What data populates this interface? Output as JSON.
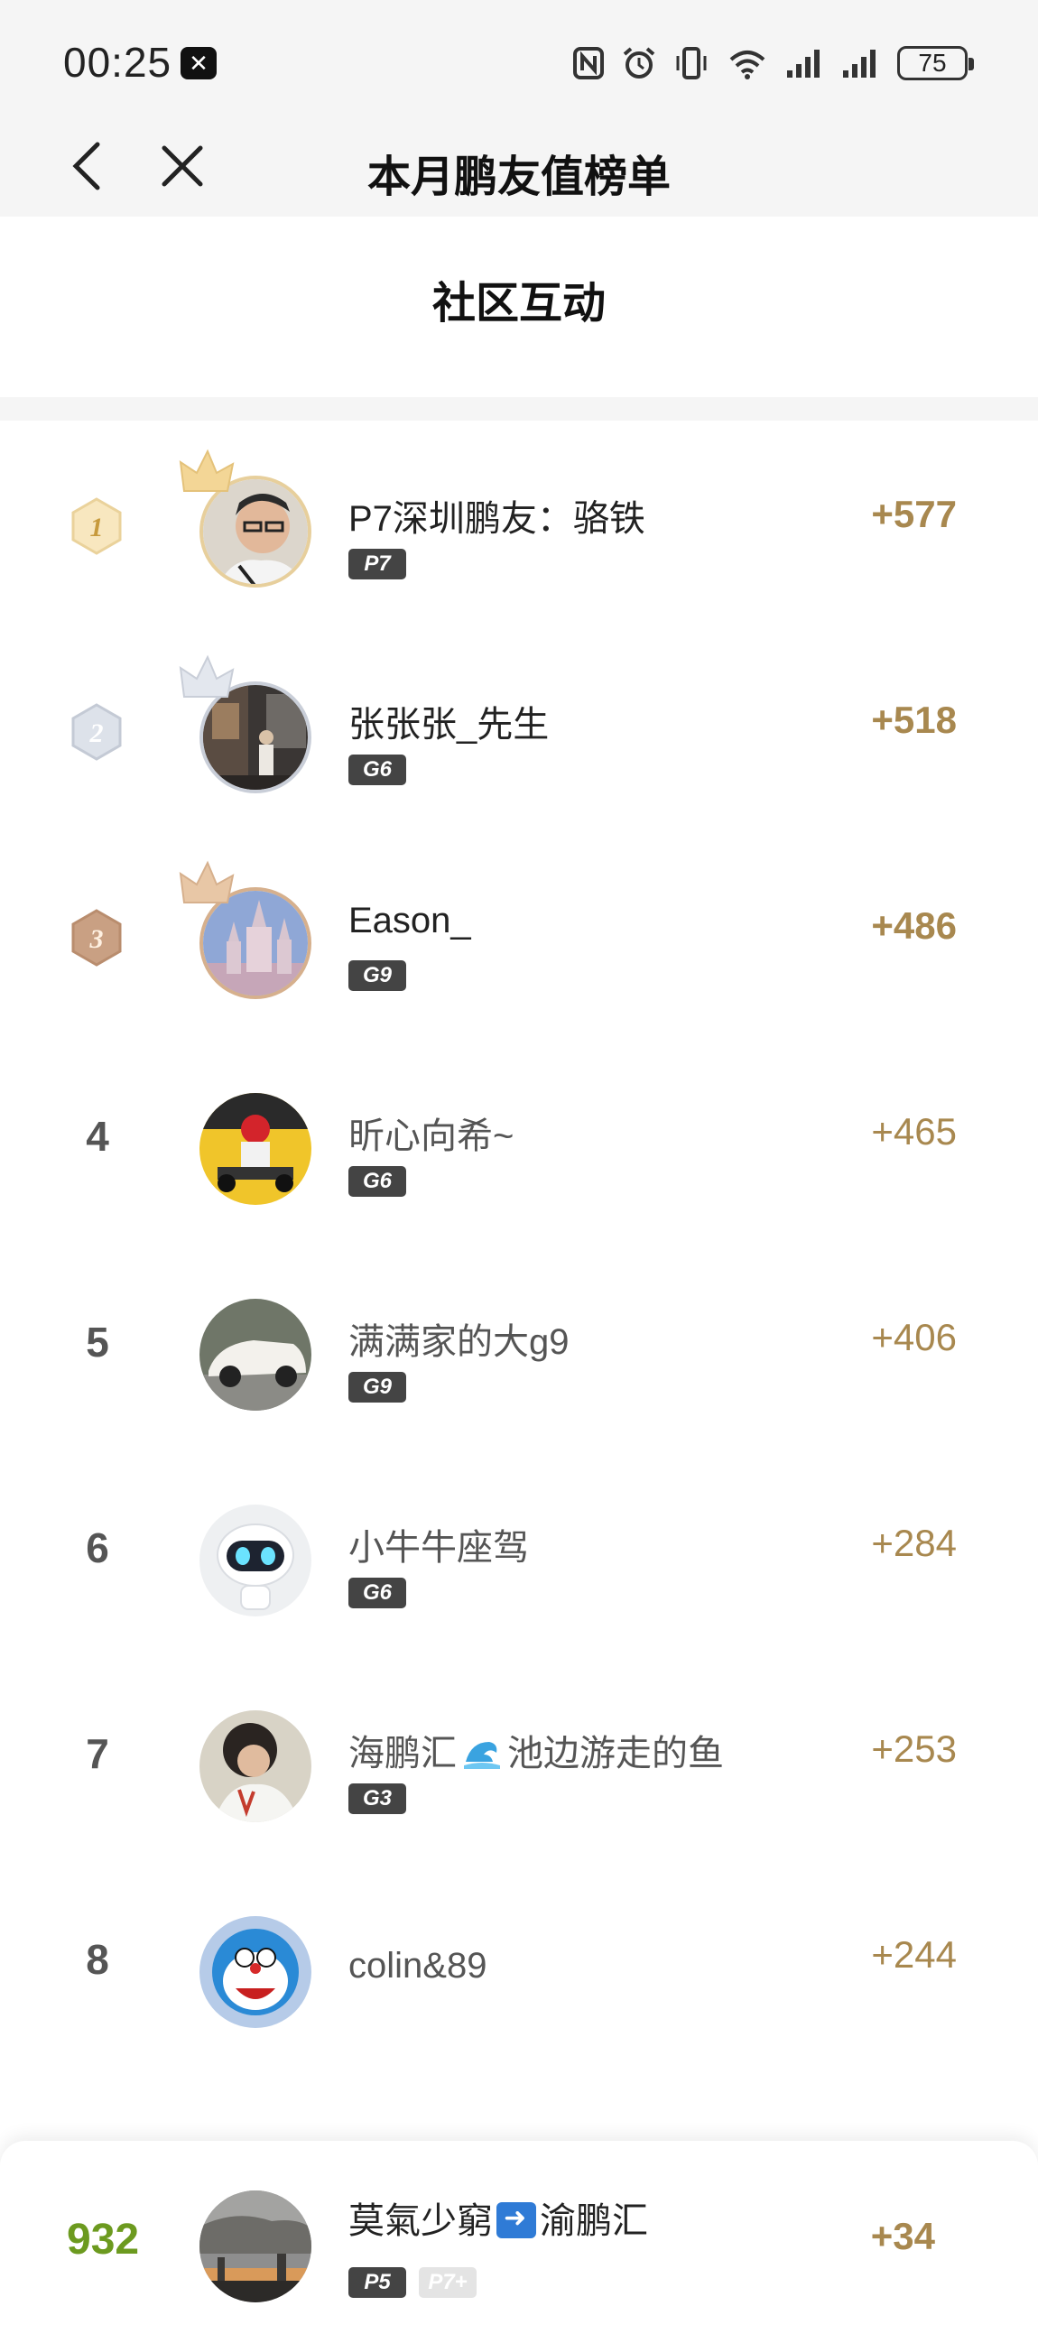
{
  "status_bar": {
    "time": "00:25",
    "battery": "75"
  },
  "nav": {
    "title": "本月鹏友值榜单"
  },
  "section": {
    "title": "社区互动"
  },
  "leaderboard": [
    {
      "rank": "1",
      "name": "P7深圳鹏友：骆铁",
      "badges": [
        "P7"
      ],
      "score": "+577"
    },
    {
      "rank": "2",
      "name": "张张张_先生",
      "badges": [
        "G6"
      ],
      "score": "+518"
    },
    {
      "rank": "3",
      "name": "Eason_",
      "badges": [
        "G9"
      ],
      "score": "+486"
    },
    {
      "rank": "4",
      "name": "昕心向希~",
      "badges": [
        "G6"
      ],
      "score": "+465"
    },
    {
      "rank": "5",
      "name": "满满家的大g9",
      "badges": [
        "G9"
      ],
      "score": "+406"
    },
    {
      "rank": "6",
      "name": "小牛牛座驾",
      "badges": [
        "G6"
      ],
      "score": "+284"
    },
    {
      "rank": "7",
      "name_part1": "海鹏汇",
      "name_part2": "池边游走的鱼",
      "badges": [
        "G3"
      ],
      "score": "+253"
    },
    {
      "rank": "8",
      "name": "colin&89",
      "badges": [],
      "score": "+244"
    }
  ],
  "my_rank": {
    "rank": "932",
    "name_part1": "莫氣少窮",
    "name_part2": "渝鹏汇",
    "badges": [
      "P5",
      "P7+"
    ],
    "score": "+34"
  },
  "colors": {
    "score": "#a8884f",
    "my_rank": "#6c9a1f",
    "gold": "#e7cf9c",
    "silver": "#c9ced8",
    "bronze": "#d6b08d"
  }
}
